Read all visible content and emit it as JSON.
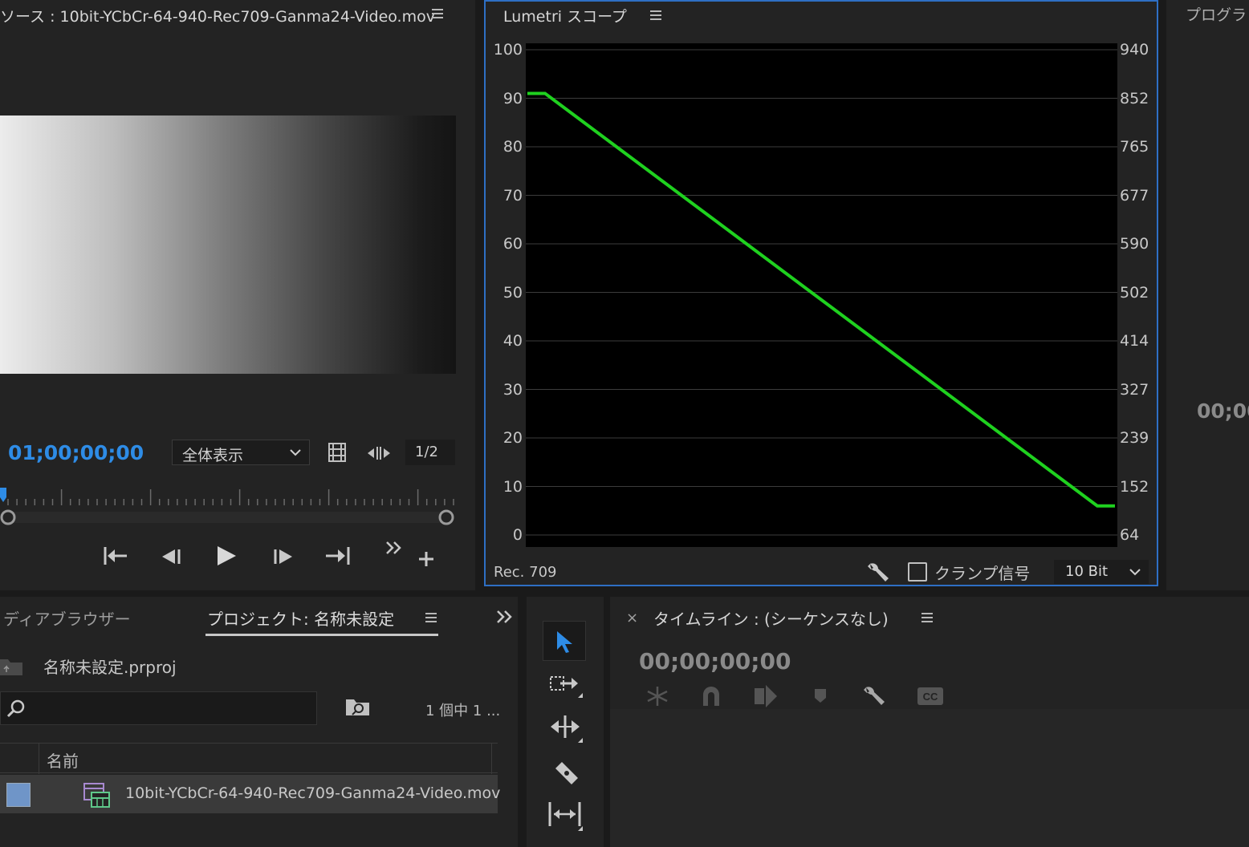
{
  "source": {
    "title": "ソース : 10bit-YCbCr-64-940-Rec709-Ganma24-Video.mov",
    "timecode": "01;00;00;00",
    "zoom_dropdown": "全体表示",
    "resolution": "1/2",
    "icons": [
      "menu-icon",
      "film-strip-icon",
      "trim-arrows-icon",
      "go-to-in-icon",
      "step-back-icon",
      "play-icon",
      "step-forward-icon",
      "go-to-out-icon",
      "more-icon",
      "add-icon"
    ]
  },
  "scope": {
    "title": "Lumetri スコープ",
    "left_labels": [
      "100",
      "90",
      "80",
      "70",
      "60",
      "50",
      "40",
      "30",
      "20",
      "10",
      "0"
    ],
    "right_labels": [
      "940",
      "852",
      "765",
      "677",
      "590",
      "502",
      "414",
      "327",
      "239",
      "152",
      "64"
    ],
    "colorspace": "Rec. 709",
    "clamp_label": "クランプ信号",
    "bit_depth": "10 Bit",
    "trace_color": "#1fd11f",
    "waveform": {
      "plateau_start": 91,
      "plateau_end": 6
    }
  },
  "program": {
    "title": "プログラ",
    "timecode": "00;00"
  },
  "project": {
    "tab_media_browser": "ディアブラウザー",
    "tab_project": "プロジェクト: 名称未設定",
    "file_name": "名称未設定.prproj",
    "search_placeholder": "",
    "count": "1 個中 1 ...",
    "column_name": "名前",
    "item_name": "10bit-YCbCr-64-940-Rec709-Ganma24-Video.mov",
    "item_label_color": "#6f95c8"
  },
  "timeline": {
    "title": "タイムライン : (シーケンスなし)",
    "close": "×",
    "timecode": "00;00;00;00"
  }
}
